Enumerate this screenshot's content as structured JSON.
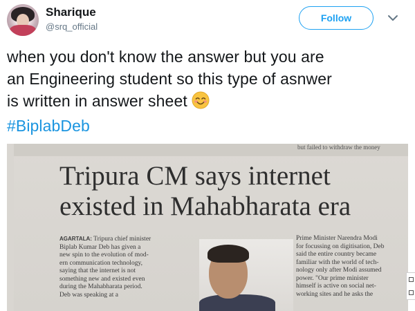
{
  "user": {
    "display_name": "Sharique",
    "screen_name": "@srq_official"
  },
  "follow_button": {
    "label": "Follow"
  },
  "tweet": {
    "lines": [
      "when you don't know the answer but you are",
      "an Engineering student so this type of asnwer",
      "is written in answer sheet"
    ],
    "hashtag": "#BiplabDeb",
    "emoji": "smiling-face-with-smiling-eyes"
  },
  "newspaper": {
    "top_line": "but failed to withdraw the money",
    "headline_line1": "Tripura CM says internet",
    "headline_line2": "existed in Mahabharata era",
    "left_dateline": "AGARTALA:",
    "left_lines": [
      "Tripura chief minister",
      "Biplab Kumar Deb has given a",
      "new spin to the evolution of mod-",
      "ern communication technology,",
      "saying that the internet is not",
      "something new and existed even",
      "during the Mahabharata period.",
      "Deb was speaking at a"
    ],
    "right_lines": [
      "Prime Minister Narendra Modi",
      "for focussing on digitisation, Deb",
      "said the entire country became",
      "familiar with the world of tech-",
      "nology only after Modi assumed",
      "power. \"Our prime minister",
      "himself is active on social net-",
      "working sites and he asks the"
    ]
  },
  "colors": {
    "accent": "#1da1f2",
    "hashtag": "#1b95e0",
    "text": "#14171a",
    "muted": "#657786",
    "emoji_face": "#f9c440",
    "emoji_cheek": "#f28b82"
  }
}
